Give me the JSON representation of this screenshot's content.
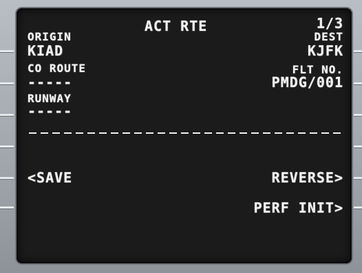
{
  "page": {
    "title": "ACT RTE",
    "page_number": "1/3"
  },
  "left": {
    "origin_label": "ORIGIN",
    "origin_value": "KIAD",
    "co_route_label": "CO ROUTE",
    "co_route_value": "-----",
    "runway_label": "RUNWAY",
    "runway_value": "-----",
    "save_prompt": "<SAVE"
  },
  "right": {
    "dest_label": "DEST",
    "dest_value": "KJFK",
    "flt_no_label": "FLT NO.",
    "flt_no_value": "PMDG/001",
    "reverse_prompt": "REVERSE>",
    "perf_init_prompt": "PERF INIT>"
  },
  "colors": {
    "screen_bg": "#1b1b1c",
    "text": "#f2f2f2",
    "bezel": "#a3a7ae"
  }
}
